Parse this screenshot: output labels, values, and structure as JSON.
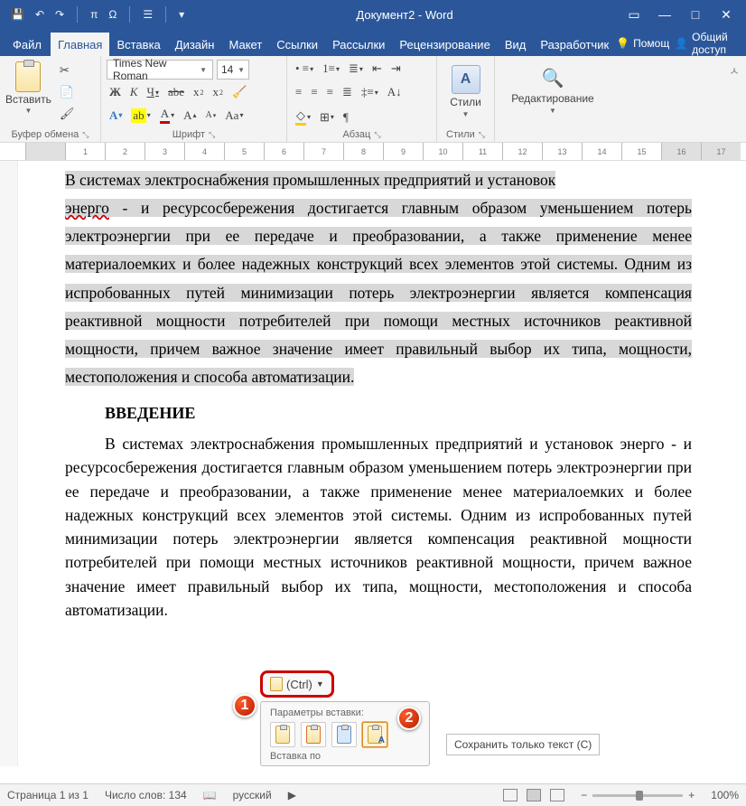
{
  "titlebar": {
    "title": "Документ2 - Word"
  },
  "tabs": {
    "file": "Файл",
    "items": [
      "Главная",
      "Вставка",
      "Дизайн",
      "Макет",
      "Ссылки",
      "Рассылки",
      "Рецензирование",
      "Вид",
      "Разработчик"
    ],
    "active_index": 0,
    "help": "Помощ",
    "share": "Общий доступ"
  },
  "ribbon": {
    "clipboard": {
      "paste": "Вставить",
      "label": "Буфер обмена"
    },
    "font": {
      "name": "Times New Roman",
      "size": "14",
      "label": "Шрифт"
    },
    "paragraph": {
      "label": "Абзац"
    },
    "styles": {
      "btn": "Стили",
      "label": "Стили"
    },
    "editing": {
      "btn": "Редактирование"
    }
  },
  "ruler_marks": [
    "",
    "1",
    "2",
    "3",
    "4",
    "5",
    "6",
    "7",
    "8",
    "9",
    "10",
    "11",
    "12",
    "13",
    "14",
    "15",
    "16",
    "17"
  ],
  "doc": {
    "p1a": "В системах электроснабжения промышленных предприятий и установок",
    "p1_energo": "энерго",
    "p1b": " - и ресурсосбережения достигается главным образом уменьшением потерь электроэнергии при ее передаче и преобразовании, а также применение менее материалоемких и более надежных конструкций всех элементов этой системы. Одним из испробованных путей минимизации потерь электроэнергии является компенсация реактивной мощности потребителей при помощи местных источников реактивной мощности, причем важное значение имеет правильный выбор их типа, мощности, местоположения и способа автоматизации.",
    "heading": "ВВЕДЕНИЕ",
    "p2": "В системах электроснабжения промышленных предприятий и установок энерго - и ресурсосбережения достигается главным образом уменьшением потерь электроэнергии при ее передаче и преобразовании, а также применение менее материалоемких и более надежных конструкций всех элементов этой системы. Одним из испробованных путей минимизации потерь электроэнергии является компенсация реактивной мощности потребителей при помощи местных источников реактивной мощности, причем важное значение имеет правильный выбор их типа, мощности, местоположения и способа автоматизации."
  },
  "paste_popup": {
    "ctrl": "(Ctrl)",
    "title": "Параметры вставки:",
    "footer": "Вставка по",
    "tooltip": "Сохранить только текст (С)"
  },
  "callouts": {
    "one": "1",
    "two": "2"
  },
  "statusbar": {
    "page": "Страница 1 из 1",
    "words": "Число слов: 134",
    "lang": "русский",
    "zoom": "100%"
  }
}
